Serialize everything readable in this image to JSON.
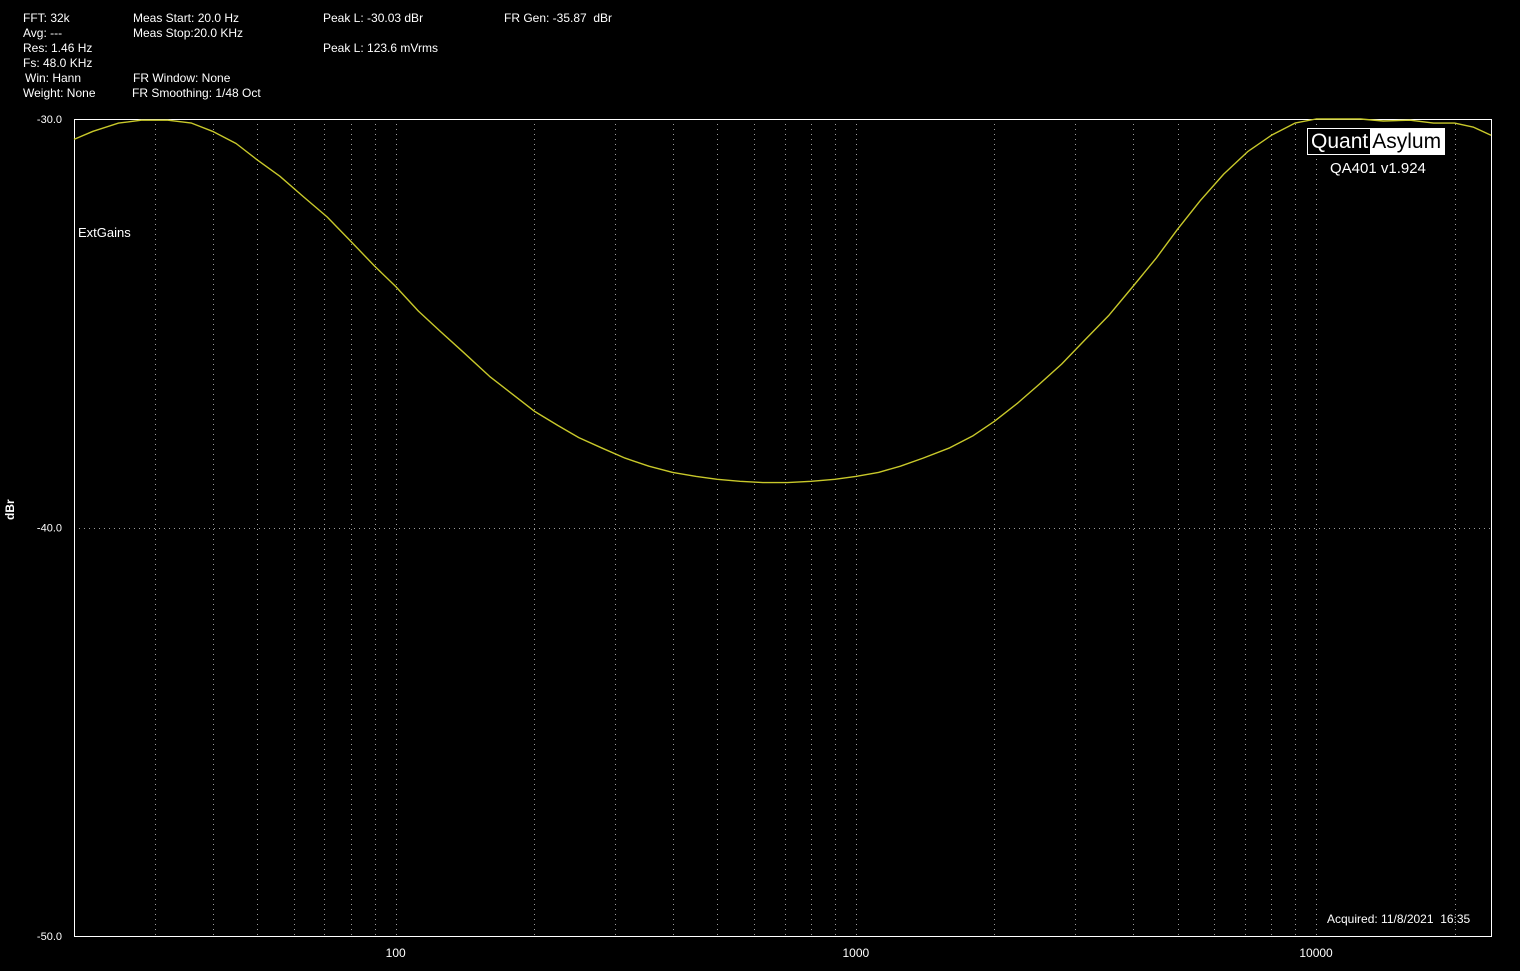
{
  "info": {
    "fft": "FFT: 32k",
    "avg": "Avg: ---",
    "res": "Res: 1.46 Hz",
    "fs": "Fs: 48.0 KHz",
    "win": "Win: Hann",
    "weight": "Weight: None",
    "meas_start": "Meas Start: 20.0 Hz",
    "meas_stop": "Meas Stop:20.0 KHz",
    "fr_window": "FR Window: None",
    "fr_smoothing": "FR Smoothing: 1/48 Oct",
    "peak_l_dbr": "Peak L: -30.03 dBr",
    "peak_l_mv": "Peak L: 123.6 mVrms",
    "fr_gen": "FR Gen: -35.87  dBr"
  },
  "logo": {
    "left": "Quant",
    "right": "Asylum",
    "version": "QA401 v1.924"
  },
  "annotation": "ExtGains",
  "acquired": "Acquired: 11/8/2021  16:35",
  "colors": {
    "trace": "#c8c82a",
    "grid": "#ffffff",
    "background": "#000000"
  },
  "chart_data": {
    "type": "line",
    "xscale": "log",
    "xlim": [
      20,
      24000
    ],
    "ylim": [
      -50,
      -30
    ],
    "ylabel": "dBr",
    "grid": true,
    "x_ticks": [
      {
        "value": 100,
        "label": "100"
      },
      {
        "value": 1000,
        "label": "1000"
      },
      {
        "value": 10000,
        "label": "10000"
      }
    ],
    "y_ticks": [
      {
        "value": -30,
        "label": "-30.0"
      },
      {
        "value": -40,
        "label": "-40.0"
      },
      {
        "value": -50,
        "label": "-50.0"
      }
    ],
    "series": [
      {
        "x": [
          20,
          22,
          25,
          28,
          32,
          36,
          40,
          45,
          50,
          56,
          63,
          71,
          80,
          90,
          100,
          112,
          125,
          140,
          160,
          180,
          200,
          225,
          250,
          280,
          315,
          355,
          400,
          450,
          500,
          560,
          630,
          710,
          800,
          900,
          1000,
          1120,
          1250,
          1400,
          1600,
          1800,
          2000,
          2250,
          2500,
          2800,
          3150,
          3550,
          4000,
          4500,
          5000,
          5600,
          6300,
          7100,
          8000,
          9000,
          10000,
          11200,
          12500,
          14000,
          16000,
          18000,
          20000,
          22000,
          24000
        ],
        "y": [
          -30.5,
          -30.3,
          -30.1,
          -30.03,
          -30.03,
          -30.1,
          -30.3,
          -30.6,
          -31.0,
          -31.4,
          -31.9,
          -32.4,
          -33.0,
          -33.6,
          -34.1,
          -34.7,
          -35.2,
          -35.7,
          -36.3,
          -36.75,
          -37.15,
          -37.5,
          -37.8,
          -38.05,
          -38.3,
          -38.5,
          -38.65,
          -38.75,
          -38.82,
          -38.87,
          -38.9,
          -38.9,
          -38.87,
          -38.82,
          -38.75,
          -38.65,
          -38.5,
          -38.3,
          -38.05,
          -37.75,
          -37.4,
          -36.95,
          -36.5,
          -36.0,
          -35.4,
          -34.8,
          -34.1,
          -33.4,
          -32.7,
          -32.0,
          -31.35,
          -30.8,
          -30.4,
          -30.1,
          -30.0,
          -30.0,
          -30.0,
          -30.05,
          -30.03,
          -30.1,
          -30.1,
          -30.2,
          -30.4
        ]
      }
    ]
  }
}
